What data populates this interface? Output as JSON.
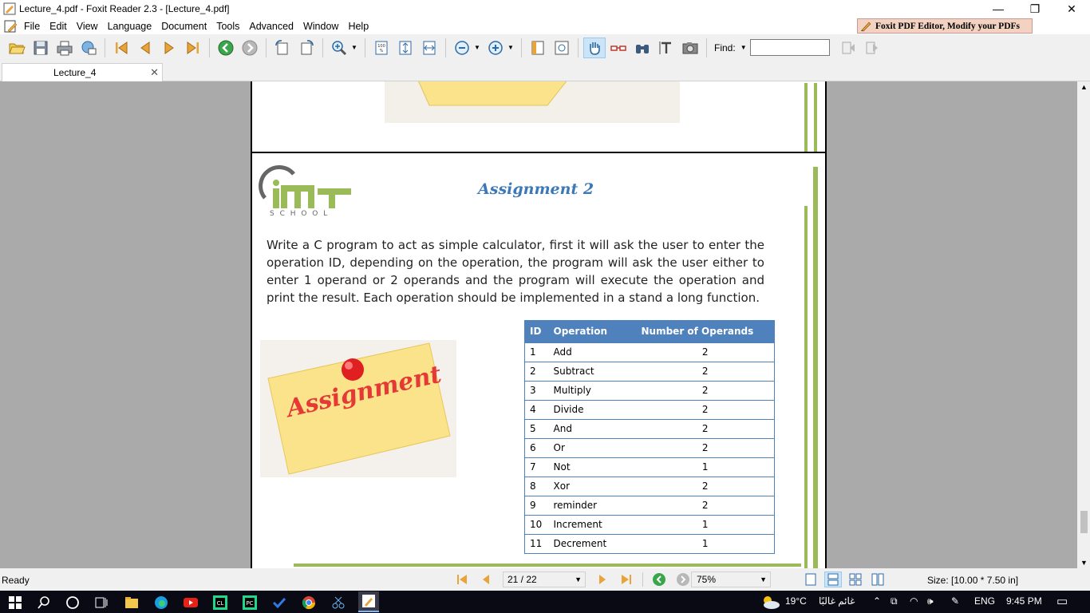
{
  "window": {
    "title": "Lecture_4.pdf - Foxit Reader 2.3 - [Lecture_4.pdf]",
    "minimize": "—",
    "restore": "❐",
    "close": "✕"
  },
  "menu": {
    "items": [
      "File",
      "Edit",
      "View",
      "Language",
      "Document",
      "Tools",
      "Advanced",
      "Window",
      "Help"
    ],
    "ad_text": "Foxit PDF Editor, Modify your PDFs"
  },
  "toolbar": {
    "find_label": "Find:",
    "find_value": ""
  },
  "tab": {
    "label": "Lecture_4",
    "close": "✕"
  },
  "document": {
    "logo_text": "IMT",
    "logo_sub": "S C H O O L",
    "title": "Assignment 2",
    "description": "Write a C program to act as simple calculator, first it will ask the user to enter the operation ID, depending on the operation, the program will ask the user either to enter 1 operand or 2 operands and the program will execute the operation and print the result. Each operation should be implemented in a stand a long function.",
    "sticky_note_text": "Assignment",
    "table": {
      "headers": [
        "ID",
        "Operation",
        "Number of Operands"
      ],
      "rows": [
        [
          "1",
          "Add",
          "2"
        ],
        [
          "2",
          "Subtract",
          "2"
        ],
        [
          "3",
          "Multiply",
          "2"
        ],
        [
          "4",
          "Divide",
          "2"
        ],
        [
          "5",
          "And",
          "2"
        ],
        [
          "6",
          "Or",
          "2"
        ],
        [
          "7",
          "Not",
          "1"
        ],
        [
          "8",
          "Xor",
          "2"
        ],
        [
          "9",
          "reminder",
          "2"
        ],
        [
          "10",
          "Increment",
          "1"
        ],
        [
          "11",
          "Decrement",
          "1"
        ]
      ]
    }
  },
  "status": {
    "text": "Ready",
    "page": "21 / 22",
    "zoom": "75%",
    "page_size": "Size: [10.00 * 7.50 in]"
  },
  "taskbar": {
    "weather": "19°C",
    "weather_desc": "غائم غالبًا",
    "language": "ENG",
    "time": "9:45 PM"
  },
  "colors": {
    "accent_green": "#9bbb59",
    "table_header": "#4f81bd",
    "title_blue": "#3b78b9"
  }
}
